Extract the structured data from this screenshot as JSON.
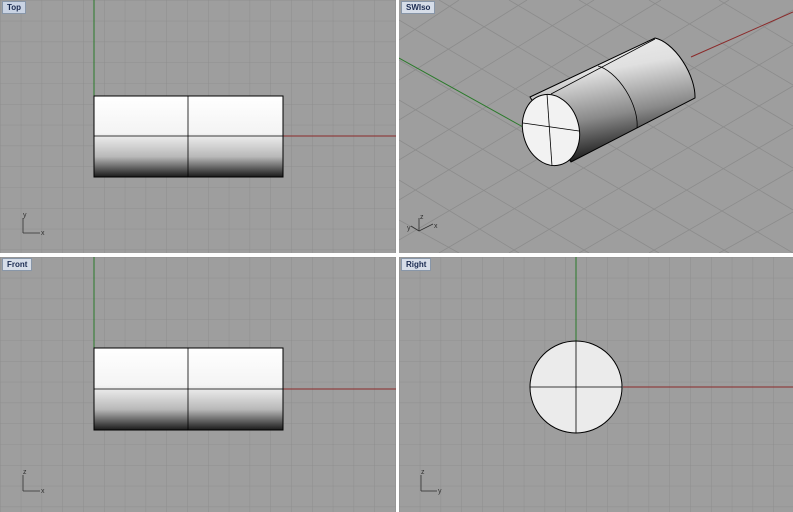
{
  "viewports": {
    "top": {
      "title": "Top",
      "axis_x": "x",
      "axis_y": "y"
    },
    "swiso": {
      "title": "SWIso",
      "axis_x": "x",
      "axis_y": "y",
      "axis_z": "z"
    },
    "front": {
      "title": "Front",
      "axis_x": "x",
      "axis_y": "z"
    },
    "right": {
      "title": "Right",
      "axis_x": "y",
      "axis_y": "z"
    }
  },
  "colors": {
    "background": "#9e9e9e",
    "grid": "#8c8c8c",
    "x_axis": "#8b2a2a",
    "y_axis": "#2a7a2a",
    "object_edge": "#000000"
  }
}
